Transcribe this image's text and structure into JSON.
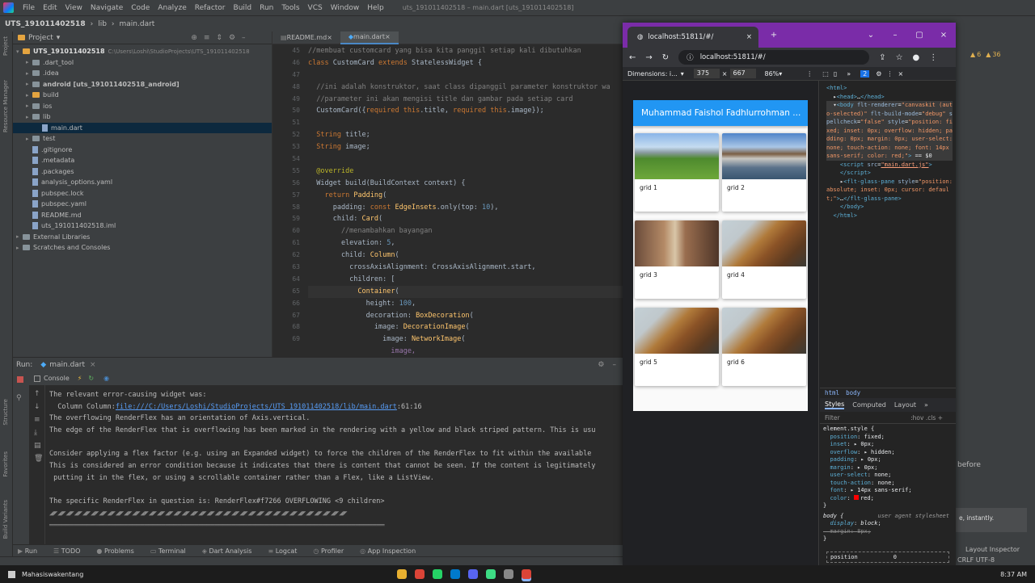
{
  "menubar": {
    "items": [
      "File",
      "Edit",
      "View",
      "Navigate",
      "Code",
      "Analyze",
      "Refactor",
      "Build",
      "Run",
      "Tools",
      "VCS",
      "Window",
      "Help"
    ],
    "window_title": "uts_191011402518 – main.dart [uts_191011402518]"
  },
  "navbar": {
    "project": "UTS_191011402518",
    "lib": "lib",
    "file": "main.dart"
  },
  "left_tabs": [
    "Project",
    "Resource Manager",
    "Structure",
    "Favorites",
    "Build Variants"
  ],
  "project_panel": {
    "title": "Project",
    "root": "UTS_191011402518",
    "root_path": "C:\\Users\\Loshi\\StudioProjects\\UTS_191011402518",
    "items": [
      {
        "label": ".dart_tool",
        "type": "folder",
        "depth": 1
      },
      {
        "label": ".idea",
        "type": "folder",
        "depth": 1
      },
      {
        "label": "android [uts_191011402518_android]",
        "type": "folder",
        "depth": 1
      },
      {
        "label": "build",
        "type": "folder-b",
        "depth": 1
      },
      {
        "label": "ios",
        "type": "folder",
        "depth": 1
      },
      {
        "label": "lib",
        "type": "folder",
        "depth": 1
      },
      {
        "label": "main.dart",
        "type": "file",
        "depth": 2,
        "selected": true
      },
      {
        "label": "test",
        "type": "folder",
        "depth": 1
      },
      {
        "label": ".gitignore",
        "type": "file",
        "depth": 1
      },
      {
        "label": ".metadata",
        "type": "file",
        "depth": 1
      },
      {
        "label": ".packages",
        "type": "file",
        "depth": 1
      },
      {
        "label": "analysis_options.yaml",
        "type": "file",
        "depth": 1
      },
      {
        "label": "pubspec.lock",
        "type": "file",
        "depth": 1
      },
      {
        "label": "pubspec.yaml",
        "type": "file",
        "depth": 1
      },
      {
        "label": "README.md",
        "type": "file",
        "depth": 1
      },
      {
        "label": "uts_191011402518.iml",
        "type": "file",
        "depth": 1
      },
      {
        "label": "External Libraries",
        "type": "folder",
        "depth": 0
      },
      {
        "label": "Scratches and Consoles",
        "type": "folder",
        "depth": 0
      }
    ]
  },
  "editor": {
    "tabs": [
      {
        "label": "README.md",
        "active": false
      },
      {
        "label": "main.dart",
        "active": true
      }
    ],
    "line_numbers": [
      "45",
      "46",
      "47",
      "48",
      "49",
      "50",
      "51",
      "52",
      "53",
      "54",
      "55",
      "56",
      "57",
      "58",
      "59",
      "60",
      "61",
      "62",
      "63",
      "64",
      "65",
      "66",
      "67",
      "68",
      "69"
    ],
    "lines": [
      "//membuat customcard yang bisa kita panggil setiap kali dibutuhkan",
      "class CustomCard extends StatelessWidget {",
      "",
      "  //ini adalah konstruktor, saat class dipanggil parameter konstruktor wa",
      "  //parameter ini akan mengisi title dan gambar pada setiap card",
      "  CustomCard({required this.title, required this.image});",
      "",
      "  String title;",
      "  String image;",
      "",
      "  @override",
      "  Widget build(BuildContext context) {",
      "    return Padding(",
      "      padding: const EdgeInsets.only(top: 10),",
      "      child: Card(",
      "        //menambahkan bayangan",
      "        elevation: 5,",
      "        child: Column(",
      "          crossAxisAlignment: CrossAxisAlignment.start,",
      "          children: [",
      "            Container(",
      "              height: 100,",
      "              decoration: BoxDecoration(",
      "                image: DecorationImage(",
      "                  image: NetworkImage("
    ],
    "extra_line": "                    image,"
  },
  "run": {
    "label": "Run:",
    "config": "main.dart",
    "console_tab": "Console",
    "lines": [
      "The relevant error-causing widget was:",
      "  Column Column:",
      "The overflowing RenderFlex has an orientation of Axis.vertical.",
      "The edge of the RenderFlex that is overflowing has been marked in the rendering with a yellow and black striped pattern. This is usu",
      "",
      "Consider applying a flex factor (e.g. using an Expanded widget) to force the children of the RenderFlex to fit within the available",
      "This is considered an error condition because it indicates that there is content that cannot be seen. If the content is legitimately",
      " putting it in the flex, or using a scrollable container rather than a Flex, like a ListView.",
      "",
      "The specific RenderFlex in question is: RenderFlex#f7266 OVERFLOWING <9 children>",
      "◢◤◢◤◢◤◢◤◢◤◢◤◢◤◢◤◢◤◢◤◢◤◢◤◢◤◢◤◢◤◢◤◢◤◢◤◢◤◢◤◢◤◢◤◢◤◢◤◢◤◢◤◢◤◢◤◢◤◢◤◢◤◢◤◢◤◢◤◢◤◢◤",
      "═════════════════════════════════════════════════════════════════════════════════"
    ],
    "link": "file:///C:/Users/Loshi/StudioProjects/UTS_191011402518/lib/main.dart",
    "link_suffix": ":61:16"
  },
  "bottom_tabs": [
    "Run",
    "TODO",
    "Problems",
    "Terminal",
    "Dart Analysis",
    "Logcat",
    "Profiler",
    "App Inspection"
  ],
  "ide_right": {
    "text1": "before",
    "text2": "e, instantly.",
    "layout_inspector": "Layout Inspector",
    "encoding": "CRLF  UTF-8",
    "warnings": "6",
    "weak": "36"
  },
  "browser": {
    "tab_title": "localhost:51811/#/",
    "url": "localhost:51811/#/",
    "dimensions_label": "Dimensions: i...",
    "width": "375",
    "height": "667",
    "zoom": "86%",
    "app": {
      "title": "Muhammad Faishol Fadhlurrohman ...",
      "cards": [
        {
          "caption": "grid 1",
          "img": "meadow"
        },
        {
          "caption": "grid 2",
          "img": "lake"
        },
        {
          "caption": "grid 3",
          "img": "canyon"
        },
        {
          "caption": "grid 4",
          "img": "rock"
        },
        {
          "caption": "grid 5",
          "img": "rock"
        },
        {
          "caption": "grid 6",
          "img": "rock"
        }
      ]
    }
  },
  "devtools": {
    "issues": "2",
    "crumbs": [
      "html",
      "body"
    ],
    "tabs": [
      "Styles",
      "Computed",
      "Layout"
    ],
    "filter": "Filter",
    "filter_right": ":hov  .cls  +",
    "element_style_header": "element.style {",
    "element_style": [
      {
        "p": "position",
        "v": "fixed"
      },
      {
        "p": "inset",
        "v": "▸ 0px"
      },
      {
        "p": "overflow",
        "v": "▸ hidden"
      },
      {
        "p": "padding",
        "v": "▸ 0px"
      },
      {
        "p": "margin",
        "v": "▸ 0px"
      },
      {
        "p": "user-select",
        "v": "none"
      },
      {
        "p": "touch-action",
        "v": "none"
      },
      {
        "p": "font",
        "v": "▸ 14px sans-serif"
      },
      {
        "p": "color",
        "v": "red"
      }
    ],
    "body_rule": "body {",
    "ua_label": "user agent stylesheet",
    "ua_props": [
      {
        "p": "display",
        "v": "block"
      },
      {
        "p": "margin",
        "v": "8px"
      }
    ],
    "box_label": "position",
    "box_value": "0"
  },
  "taskbar": {
    "user": "Mahasiswakentang",
    "time": "8:37 AM"
  },
  "colors": {
    "accent": "#2196f3",
    "browser_frame": "#7a2ca8",
    "ide_bg": "#2b2b2b"
  }
}
